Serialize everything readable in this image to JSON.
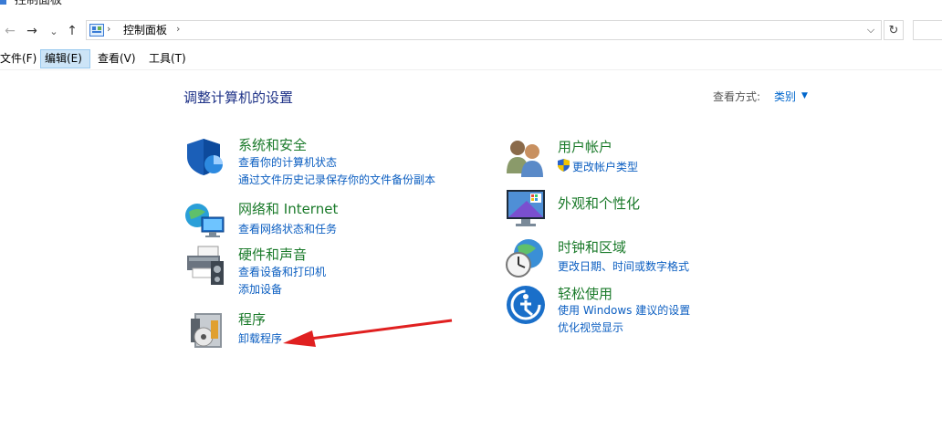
{
  "window": {
    "title": "控制面板"
  },
  "nav": {
    "back_glyph": "←",
    "forward_glyph": "→",
    "history_glyph": "⌄",
    "up_glyph": "↑",
    "breadcrumb": [
      "控制面板"
    ],
    "refresh_glyph": "↻"
  },
  "menu": {
    "items": [
      {
        "label": "文件(F)"
      },
      {
        "label": "编辑(E)"
      },
      {
        "label": "查看(V)"
      },
      {
        "label": "工具(T)"
      }
    ]
  },
  "content": {
    "title": "调整计算机的设置",
    "view_by_label": "查看方式:",
    "view_by_value": "类别",
    "categories": [
      {
        "title": "系统和安全",
        "links": [
          "查看你的计算机状态",
          "通过文件历史记录保存你的文件备份副本"
        ],
        "icon": "shield-icon"
      },
      {
        "title": "网络和 Internet",
        "links": [
          "查看网络状态和任务"
        ],
        "icon": "network-icon"
      },
      {
        "title": "硬件和声音",
        "links": [
          "查看设备和打印机",
          "添加设备"
        ],
        "icon": "printer-icon"
      },
      {
        "title": "程序",
        "links": [
          "卸载程序"
        ],
        "icon": "programs-icon"
      },
      {
        "title": "用户帐户",
        "links": [
          "更改帐户类型"
        ],
        "icon": "users-icon"
      },
      {
        "title": "外观和个性化",
        "links": [],
        "icon": "monitor-icon"
      },
      {
        "title": "时钟和区域",
        "links": [
          "更改日期、时间或数字格式"
        ],
        "icon": "clock-globe-icon"
      },
      {
        "title": "轻松使用",
        "links": [
          "使用 Windows 建议的设置",
          "优化视觉显示"
        ],
        "icon": "accessibility-icon"
      }
    ]
  },
  "colors": {
    "title_blue": "#1e3287",
    "category_green": "#1a7a2a",
    "link_blue": "#0b5ec1",
    "menu_active_bg": "#cce4f7",
    "annotation_arrow": "#e02020"
  }
}
